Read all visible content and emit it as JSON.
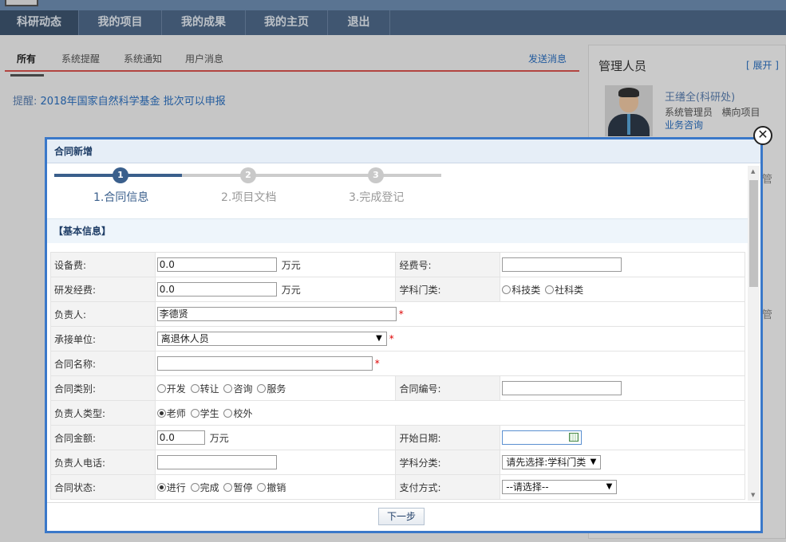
{
  "nav": {
    "items": [
      "科研动态",
      "我的项目",
      "我的成果",
      "我的主页",
      "退出"
    ]
  },
  "feed": {
    "tabs": [
      "所有",
      "系统提醒",
      "系统通知",
      "用户消息"
    ],
    "send_message": "发送消息",
    "remind_prefix": "提醒:",
    "remind_text": "2018年国家自然科学基金 批次可以申报"
  },
  "managers": {
    "title": "管理人员",
    "expand": "[ 展开 ]",
    "person_name": "王缮全(科研处)",
    "person_role": "系统管理员   横向项目",
    "person_link": "业务咨询",
    "frag1": "管",
    "frag2": "管"
  },
  "modal": {
    "title": "合同新增",
    "close_glyph": "✕",
    "steps": [
      {
        "num": "1",
        "label": "1.合同信息",
        "active": true
      },
      {
        "num": "2",
        "label": "2.项目文档",
        "active": false
      },
      {
        "num": "3",
        "label": "3.完成登记",
        "active": false
      }
    ],
    "section_title": "【基本信息】",
    "next_button": "下一步"
  },
  "form": {
    "equipment_fee": {
      "label": "设备费:",
      "value": "0.0",
      "unit": "万元"
    },
    "fund_no": {
      "label": "经费号:",
      "value": ""
    },
    "rd_fee": {
      "label": "研发经费:",
      "value": "0.0",
      "unit": "万元"
    },
    "discipline_type": {
      "label": "学科门类:",
      "options": [
        "科技类",
        "社科类"
      ]
    },
    "leader": {
      "label": "负责人:",
      "value": "李德贤",
      "required": "*"
    },
    "unit": {
      "label": "承接单位:",
      "value": "离退休人员",
      "required": "*"
    },
    "contract_name": {
      "label": "合同名称:",
      "value": "",
      "required": "*"
    },
    "contract_type": {
      "label": "合同类别:",
      "options": [
        "开发",
        "转让",
        "咨询",
        "服务"
      ]
    },
    "contract_no": {
      "label": "合同编号:",
      "value": ""
    },
    "leader_type": {
      "label": "负责人类型:",
      "options": [
        "老师",
        "学生",
        "校外"
      ],
      "selected": "老师"
    },
    "contract_amount": {
      "label": "合同金额:",
      "value": "0.0",
      "unit": "万元"
    },
    "start_date": {
      "label": "开始日期:",
      "value": ""
    },
    "leader_phone": {
      "label": "负责人电话:",
      "value": ""
    },
    "discipline_class": {
      "label": "学科分类:",
      "value": "请先选择:学科门类"
    },
    "contract_status": {
      "label": "合同状态:",
      "options": [
        "进行",
        "完成",
        "暂停",
        "撤销"
      ],
      "selected": "进行"
    },
    "payment": {
      "label": "支付方式:",
      "value": "--请选择--"
    }
  },
  "colors": {
    "nav_bg": "#4f6a8a",
    "modal_border": "#3a78c9",
    "step_active": "#3a5f8c",
    "step_inactive": "#cccccc",
    "tab_underline": "#d9534f",
    "link": "#2a6fc0"
  }
}
